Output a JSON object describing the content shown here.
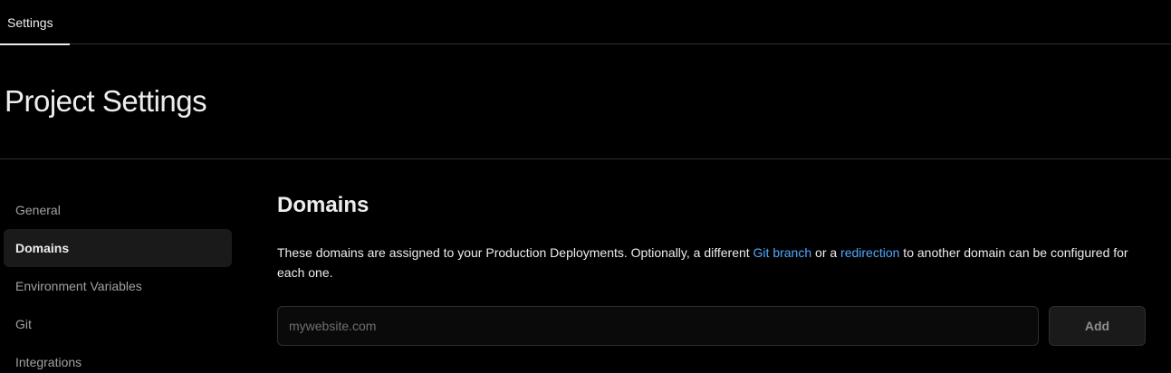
{
  "topbar": {
    "tabs": [
      {
        "label": "Settings",
        "active": true
      }
    ]
  },
  "header": {
    "title": "Project Settings"
  },
  "sidebar": {
    "items": [
      {
        "label": "General",
        "active": false
      },
      {
        "label": "Domains",
        "active": true
      },
      {
        "label": "Environment Variables",
        "active": false
      },
      {
        "label": "Git",
        "active": false
      },
      {
        "label": "Integrations",
        "active": false
      }
    ]
  },
  "main": {
    "section_title": "Domains",
    "description": {
      "part1": "These domains are assigned to your Production Deployments. Optionally, a different ",
      "link1": "Git branch",
      "part2": " or a ",
      "link2": "redirection",
      "part3": " to another domain can be configured for each one."
    },
    "domain_input": {
      "value": "",
      "placeholder": "mywebsite.com"
    },
    "add_button_label": "Add"
  },
  "colors": {
    "background": "#000000",
    "text": "#ededed",
    "muted_text": "#a1a1a1",
    "link": "#52a8ff",
    "border": "#2e2e2e",
    "active_bg": "#1a1a1a"
  }
}
